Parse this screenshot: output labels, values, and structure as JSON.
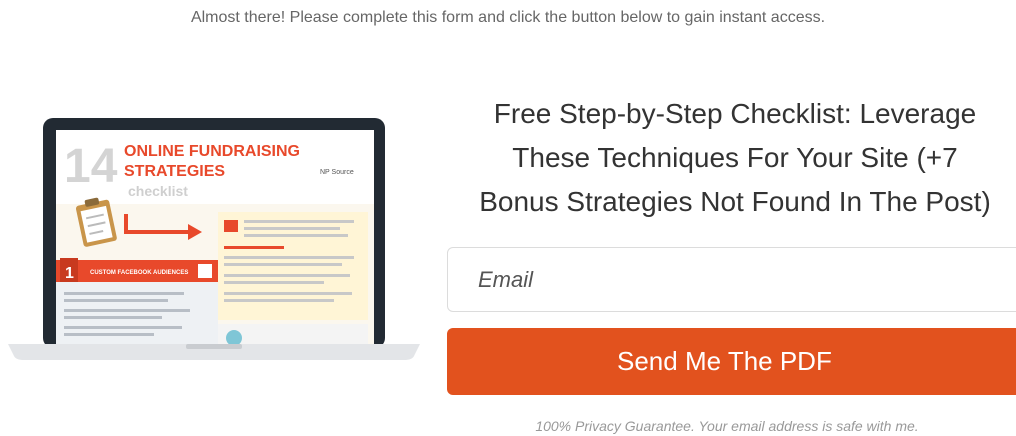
{
  "notice": "Almost there! Please complete this form and click the button below to gain instant access.",
  "headline": {
    "line1": "Free Step-by-Step Checklist: Leverage",
    "line2": "These Techniques For Your Site (+7",
    "line3": "Bonus Strategies Not Found In The Post)"
  },
  "form": {
    "email_placeholder": "Email",
    "submit_label": "Send Me The PDF",
    "privacy": "100% Privacy Guarantee. Your email address is safe with me."
  },
  "preview": {
    "number": "14",
    "title_line1": "ONLINE FUNDRAISING",
    "title_line2": "STRATEGIES",
    "subtitle": "checklist",
    "brand": "NP Source",
    "step_number": "1",
    "step_label": "CUSTOM FACEBOOK AUDIENCES"
  },
  "colors": {
    "accent": "#e2521e",
    "preview_red": "#e8492b",
    "laptop_frame": "#222a33",
    "laptop_base": "#e3e5e8"
  }
}
